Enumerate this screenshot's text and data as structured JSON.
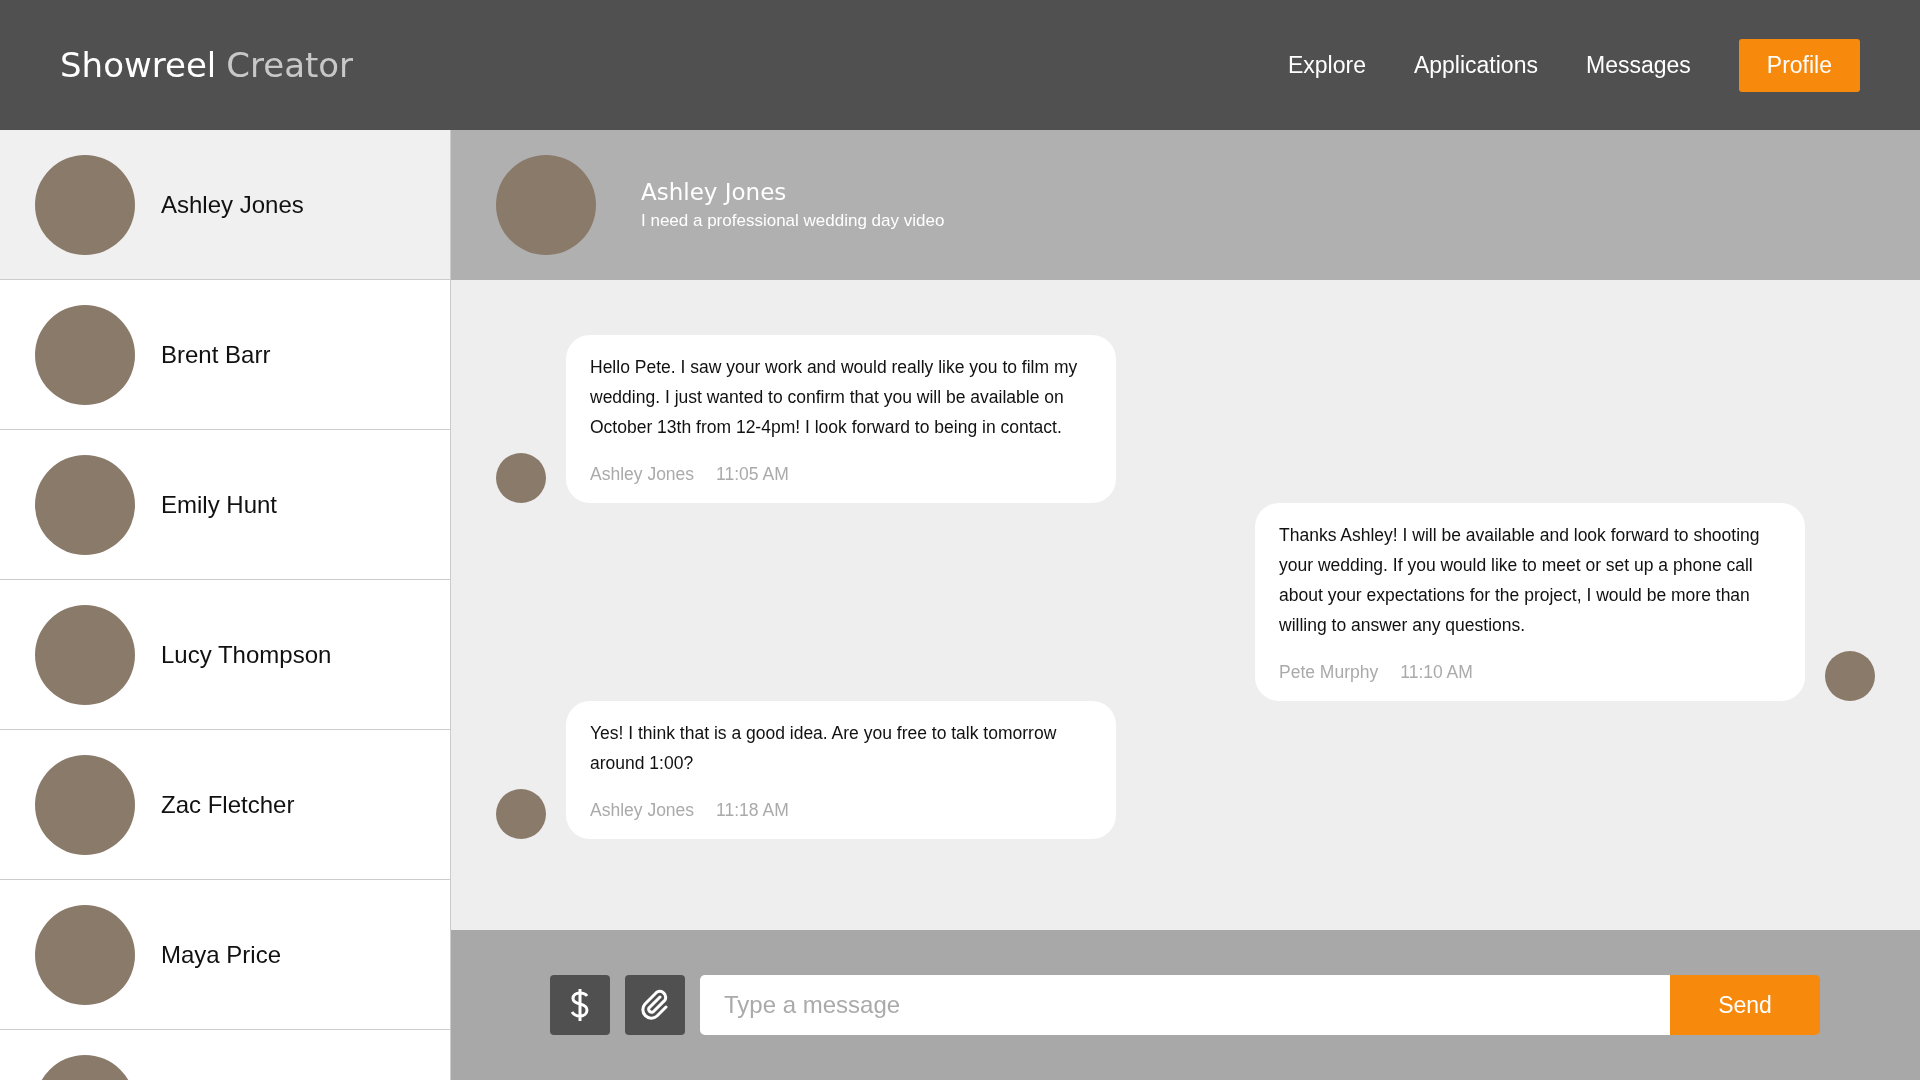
{
  "logo": {
    "primary": "Showreel",
    "secondary": "Creator"
  },
  "nav": [
    {
      "label": "Explore",
      "kind": "link"
    },
    {
      "label": "Applications",
      "kind": "link"
    },
    {
      "label": "Messages",
      "kind": "link"
    },
    {
      "label": "Profile",
      "kind": "primary"
    }
  ],
  "contacts": [
    {
      "name": "Ashley Jones",
      "selected": true
    },
    {
      "name": "Brent Barr",
      "selected": false
    },
    {
      "name": "Emily Hunt",
      "selected": false
    },
    {
      "name": "Lucy Thompson",
      "selected": false
    },
    {
      "name": "Zac Fletcher",
      "selected": false
    },
    {
      "name": "Maya Price",
      "selected": false
    },
    {
      "selected": false
    }
  ],
  "conversation": {
    "name": "Ashley Jones",
    "subtitle": "I need a professional wedding day video"
  },
  "messages": [
    {
      "kind": "incoming",
      "text": "Hello Pete. I saw your work and would really like you to film my wedding. I just wanted to confirm that you will be available on October 13th from 12-4pm! I look forward to being in contact.",
      "sender": "Ashley Jones",
      "time": "11:05 AM"
    },
    {
      "kind": "outgoing",
      "text": "Thanks Ashley! I will be available and look forward to shooting your wedding. If you would like to meet or set up a phone call about your expectations for the project, I would be more than willing to answer any questions.",
      "sender": "Pete Murphy",
      "time": "11:10 AM"
    },
    {
      "kind": "incoming",
      "text": "Yes! I think that is a good idea. Are you free to talk tomorrow around 1:00?",
      "sender": "Ashley Jones",
      "time": "11:18 AM"
    }
  ],
  "composer": {
    "placeholder": "Type a message",
    "send": "Send"
  }
}
